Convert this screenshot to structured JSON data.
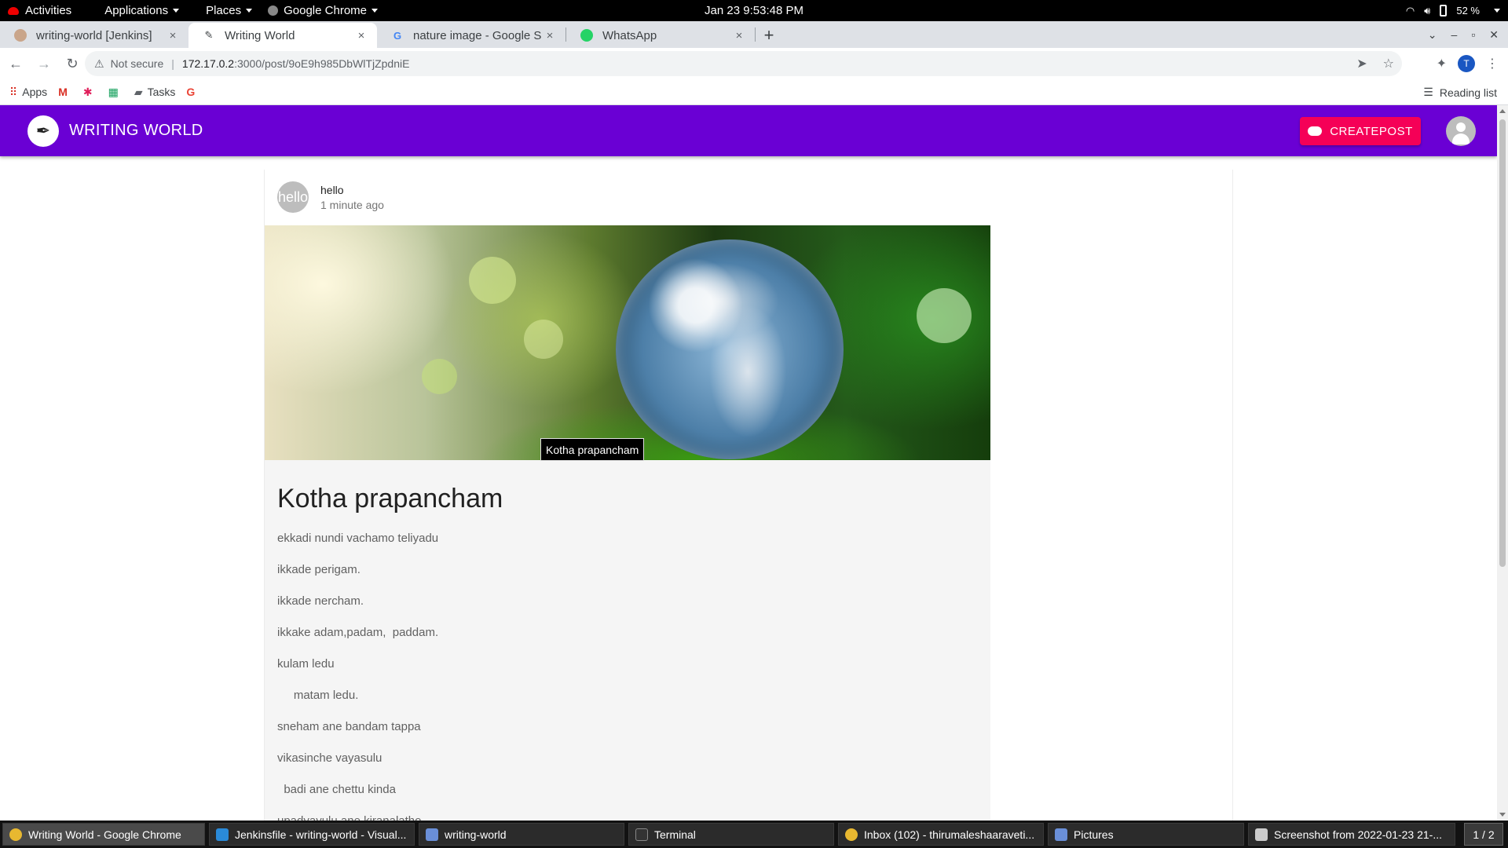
{
  "gnome": {
    "activities": "Activities",
    "applications": "Applications",
    "places": "Places",
    "app_menu": "Google Chrome",
    "clock": "Jan 23  9:53:48 PM",
    "battery": "52 %"
  },
  "tabs": [
    {
      "title": "writing-world [Jenkins]",
      "icon": "jenkins-icon",
      "close": "×"
    },
    {
      "title": "Writing World",
      "icon": "quill-icon",
      "close": "×"
    },
    {
      "title": "nature image - Google Sea",
      "icon": "google-icon",
      "close": "×"
    },
    {
      "title": "WhatsApp",
      "icon": "whatsapp-icon",
      "close": "×"
    }
  ],
  "new_tab": "+",
  "omnibox": {
    "security": "Not secure",
    "host": "172.17.0.2",
    "path": ":3000/post/9oE9h985DbWlTjZpdniE"
  },
  "bookmarks": {
    "apps": "Apps",
    "tasks": "Tasks",
    "reading_list": "Reading list"
  },
  "app": {
    "brand": "WRITING WORLD",
    "create_label": "CREATEPOST"
  },
  "post": {
    "author": "hello",
    "avatar_text": "hello",
    "time": "1 minute ago",
    "image_tooltip": "Kotha prapancham",
    "title": "Kotha prapancham",
    "paragraphs": [
      "ekkadi nundi vachamo teliyadu",
      "ikkade perigam.",
      "ikkade nercham.",
      "ikkake adam,padam,  paddam.",
      "kulam ledu",
      "     matam ledu.",
      "sneham ane bandam tappa",
      "vikasinche vayasulu",
      "  badi ane chettu kinda",
      "upadyayulu ane kiranalatho"
    ]
  },
  "taskbar": [
    {
      "label": "Writing World - Google Chrome",
      "icon": "chrome-icon"
    },
    {
      "label": "Jenkinsfile - writing-world - Visual...",
      "icon": "vscode-icon"
    },
    {
      "label": "writing-world",
      "icon": "files-icon"
    },
    {
      "label": "Terminal",
      "icon": "terminal-icon"
    },
    {
      "label": "Inbox (102) - thirumaleshaaraveti...",
      "icon": "chrome-icon"
    },
    {
      "label": "Pictures",
      "icon": "files-icon"
    },
    {
      "label": "Screenshot from 2022-01-23 21-...",
      "icon": "image-viewer-icon"
    }
  ],
  "workspace": "1 / 2",
  "colors": {
    "app_bar": "#6a00d4",
    "create_button": "#f50057",
    "tab_strip": "#dee1e6"
  }
}
